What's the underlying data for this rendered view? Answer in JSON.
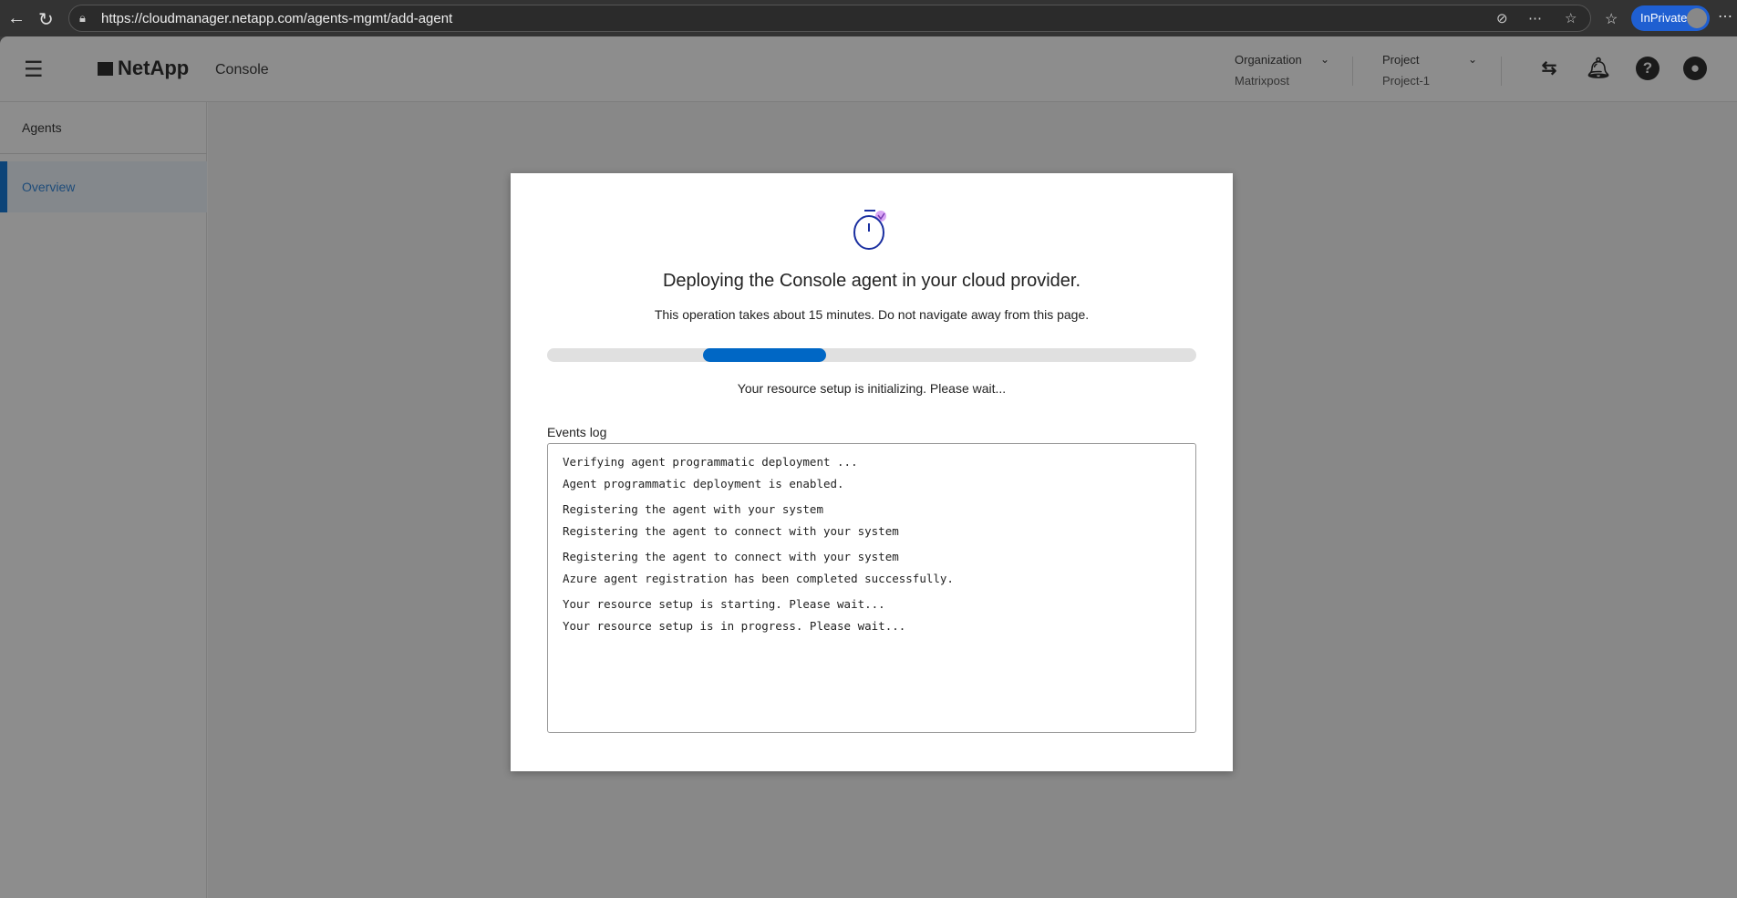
{
  "browser": {
    "url": "https://cloudmanager.netapp.com/agents-mgmt/add-agent",
    "inprivate_label": "InPrivate"
  },
  "header": {
    "brand": "NetApp",
    "product": "Console",
    "organization": {
      "label": "Organization",
      "value": "Matrixpost"
    },
    "project": {
      "label": "Project",
      "value": "Project-1"
    }
  },
  "sidebar": {
    "title": "Agents",
    "items": [
      {
        "label": "Overview",
        "active": true
      }
    ]
  },
  "modal": {
    "title": "Deploying the Console agent in your cloud provider.",
    "subtitle": "This operation takes about 15 minutes. Do not navigate away from this page.",
    "progress": {
      "type": "indeterminate",
      "segment_start": 0.24,
      "segment_end": 0.43,
      "color": "#0067c5"
    },
    "status": "Your resource setup is initializing. Please wait...",
    "events_label": "Events log",
    "events": [
      [
        "Verifying agent programmatic deployment ...",
        "Agent programmatic deployment is enabled."
      ],
      [
        "Registering the agent with your system",
        "Registering the agent to connect with your system"
      ],
      [
        "Registering the agent to connect with your system",
        "Azure agent registration has been completed successfully."
      ],
      [
        "Your resource setup is starting. Please wait...",
        "Your resource setup is in progress. Please wait..."
      ]
    ]
  }
}
